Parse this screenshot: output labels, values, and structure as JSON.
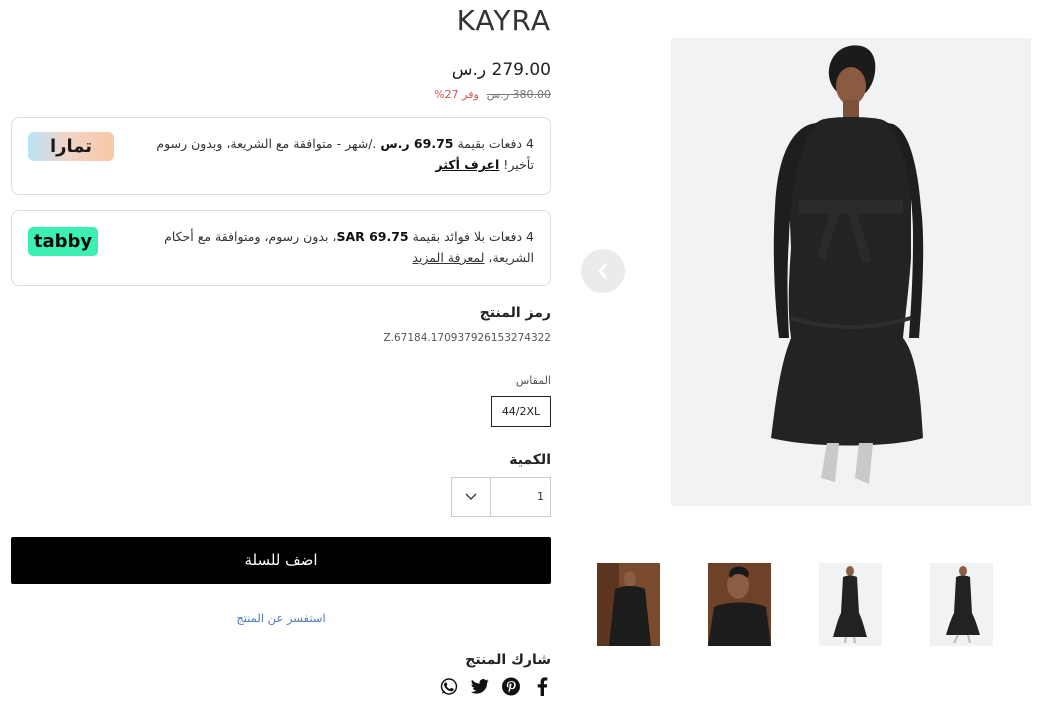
{
  "product": {
    "brand": "KAYRA",
    "price": "279.00 ر.س",
    "old_price": "380.00 ر.س",
    "save_badge": "وفر 27%"
  },
  "tamara": {
    "text_prefix": "4 دفعات بقيمة ",
    "amount": "69.75 ر.س",
    "text_suffix": " ./شهر - متوافقة مع الشريعة، وبدون رسوم تأخير! ",
    "link": "اعرف أكثر",
    "logo_text": "تمارا"
  },
  "tabby": {
    "text_prefix": "4 دفعات بلا فوائد بقيمة ",
    "amount": "SAR 69.75",
    "text_suffix": "، بدون رسوم، ومتوافقة مع أحكام الشريعة، ",
    "link": "لمعرفة المزيد",
    "logo_text": "tabby"
  },
  "sku": {
    "label": "رمز المنتج",
    "value": "Z.67184.170937926153274322"
  },
  "size": {
    "label": "المقاس",
    "value": "44/2XL"
  },
  "quantity": {
    "label": "الكمية",
    "value": "1"
  },
  "cart": {
    "add_label": "اضف للسلة"
  },
  "inquire": {
    "label": "استفسر عن المنتج"
  },
  "share": {
    "label": "شارك المنتج",
    "icons": [
      "facebook-icon",
      "pinterest-icon",
      "twitter-icon",
      "whatsapp-icon"
    ]
  },
  "gallery": {
    "thumbnail_count": 4
  },
  "colors": {
    "tabby": "#3bf0b0",
    "button": "#000000",
    "sale": "#e05050",
    "link": "#4a7bbb"
  }
}
